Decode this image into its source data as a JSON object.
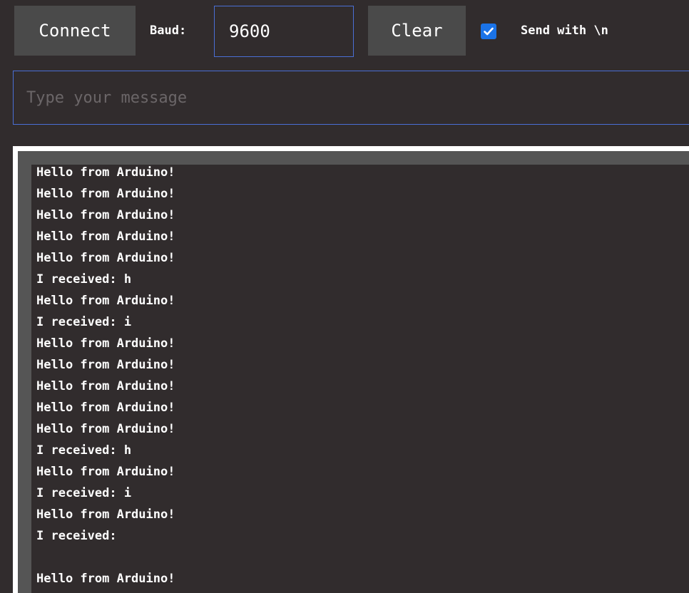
{
  "toolbar": {
    "connect_label": "Connect",
    "baud_label": "Baud:",
    "baud_value": "9600",
    "clear_label": "Clear",
    "send_newline_checked": true,
    "send_newline_label": "Send with \\n"
  },
  "message": {
    "placeholder": "Type your message",
    "value": ""
  },
  "console": {
    "lines": [
      "Hello from Arduino!",
      "Hello from Arduino!",
      "Hello from Arduino!",
      "Hello from Arduino!",
      "Hello from Arduino!",
      "I received: h",
      "Hello from Arduino!",
      "I received: i",
      "Hello from Arduino!",
      "Hello from Arduino!",
      "Hello from Arduino!",
      "Hello from Arduino!",
      "Hello from Arduino!",
      "I received: h",
      "Hello from Arduino!",
      "I received: i",
      "Hello from Arduino!",
      "I received:",
      "",
      "Hello from Arduino!"
    ]
  },
  "colors": {
    "background": "#312c2d",
    "button": "#4a4a4a",
    "accent_border": "#4a6fd6",
    "checkbox": "#1a73e8",
    "console_frame": "#ffffff",
    "console_bar": "#555555",
    "placeholder": "#6b6668"
  },
  "icons": {
    "checkbox": "checkmark-icon"
  }
}
